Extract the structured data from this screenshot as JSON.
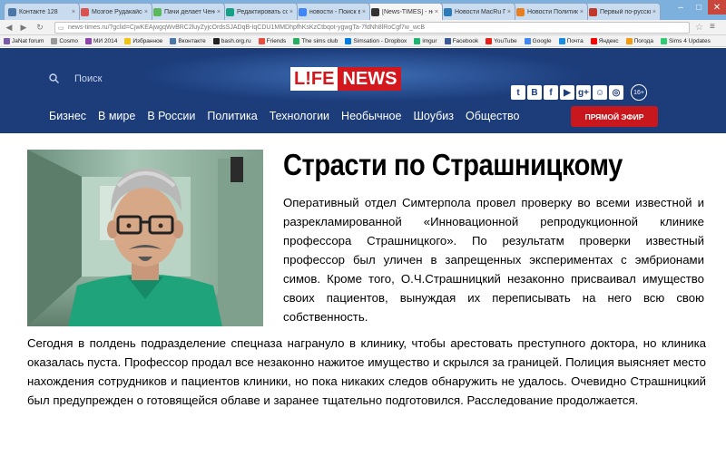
{
  "browser": {
    "tabs": [
      {
        "label": "Контакте 128",
        "color": "#4a76a8"
      },
      {
        "label": "Мозгое Рудакайсен",
        "color": "#d9534f"
      },
      {
        "label": "Пачи делает Ченом...",
        "color": "#5cb85c"
      },
      {
        "label": "Редактировать сооб...",
        "color": "#16a085"
      },
      {
        "label": "новости - Поиск в Go",
        "color": "#4285f4"
      },
      {
        "label": "[News-TIMES] - новос",
        "color": "#333333"
      },
      {
        "label": "Новости MacRu Пос...",
        "color": "#2c7bb6"
      },
      {
        "label": "Новости Политика...",
        "color": "#e67e22"
      },
      {
        "label": "Первый по-русски...",
        "color": "#c0392b"
      }
    ],
    "active_tab_index": 5,
    "url": "news-times.ru/?gclid=CjwKEAjwgqWvBRC2luyZyjcOrdsSJADqB-IqCDU1MMDhpfhKsKzCtbqot-ygwgTa-7fdNh8lRoCgf7w_wcB",
    "bookmarks": [
      {
        "label": "JaNat forum",
        "color": "#7a5aa8"
      },
      {
        "label": "Cosmo",
        "color": "#999999"
      },
      {
        "label": "МИ 2014",
        "color": "#8e44ad"
      },
      {
        "label": "Избранное",
        "color": "#f1c40f"
      },
      {
        "label": "Вконтакте",
        "color": "#4a76a8"
      },
      {
        "label": "bash.org.ru",
        "color": "#222222"
      },
      {
        "label": "Friends",
        "color": "#e74c3c"
      },
      {
        "label": "The sims club",
        "color": "#27ae60"
      },
      {
        "label": "Simsation - Dropbox",
        "color": "#007ee5"
      },
      {
        "label": "imgur",
        "color": "#1bb76e"
      },
      {
        "label": "Facebook",
        "color": "#3b5998"
      },
      {
        "label": "YouTube",
        "color": "#e62117"
      },
      {
        "label": "Google",
        "color": "#4285f4"
      },
      {
        "label": "Почта",
        "color": "#168de2"
      },
      {
        "label": "Яндекс",
        "color": "#ff0000"
      },
      {
        "label": "Погода",
        "color": "#f39c12"
      },
      {
        "label": "Sims 4 Updates",
        "color": "#2ecc71"
      }
    ]
  },
  "site": {
    "search_placeholder": "Поиск",
    "logo_left": "L!FE",
    "logo_right": "NEWS",
    "age_rating": "16+",
    "social": [
      "t",
      "B",
      "f",
      "▶",
      "g+",
      "☺",
      "◎"
    ],
    "nav": [
      "Бизнес",
      "В мире",
      "В России",
      "Политика",
      "Технологии",
      "Необычное",
      "Шоубиз",
      "Общество"
    ],
    "live_button": "ПРЯМОЙ ЭФИР",
    "colors": {
      "header": "#1c3c7a",
      "accent_red": "#c8181e"
    }
  },
  "article": {
    "title": "Страсти по Страшницкому",
    "paragraph_1": "Оперативный отдел Симтерпола провел проверку во всеми известной и разрекламированной «Инновационной репродукционной клинике профессора Страшницкого». По результатм проверки известный профессор был уличен в запрещенных экспериментах с эмбрионами симов. Кроме того, О.Ч.Страшницкий незаконно присваивал имущество своих пациентов, вынуждая их переписывать на него всю свою собственность.",
    "paragraph_2": "Сегодня в полдень подразделение спецназа награнуло в клинику, чтобы арестовать преступного доктора, но клиника оказалась пуста. Профессор продал все незаконно нажитое имущество и скрылся за границей. Полиция выясняет место нахождения сотрудников и пациентов клиники, но пока никаких следов обнаружить не удалось. Очевидно Страшницкий был предупрежден о готовящейся облаве и заранее тщательно подготовился. Расследование продолжается."
  }
}
